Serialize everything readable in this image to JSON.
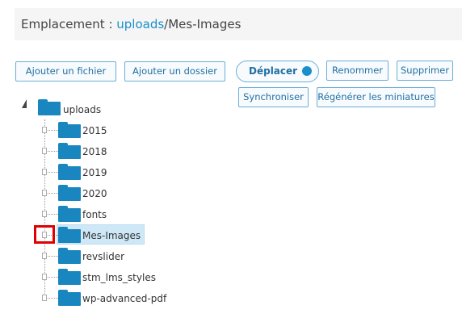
{
  "location": {
    "prefix": "Emplacement : ",
    "root_link": "uploads",
    "path_rest": "/Mes-Images"
  },
  "toolbar": {
    "add_file": "Ajouter un fichier",
    "add_folder": "Ajouter un dossier",
    "move": "Déplacer",
    "rename": "Renommer",
    "delete": "Supprimer",
    "sync": "Synchroniser",
    "regenerate": "Régénérer les miniatures"
  },
  "tree": {
    "root": "uploads",
    "children": [
      "2015",
      "2018",
      "2019",
      "2020",
      "fonts",
      "Mes-Images",
      "revslider",
      "stm_lms_styles",
      "wp-advanced-pdf"
    ],
    "selected": "Mes-Images"
  },
  "colors": {
    "accent": "#1a8fc9",
    "folder": "#1a86bf",
    "selection": "#cfe8f7",
    "highlight": "#e00000"
  }
}
